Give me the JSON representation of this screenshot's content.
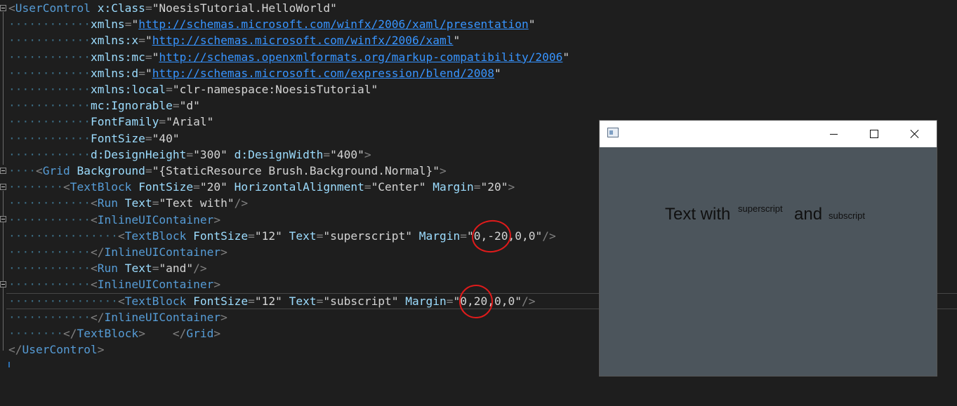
{
  "editor": {
    "lines": [
      {
        "indent": "",
        "parts": [
          [
            "pun",
            "<"
          ],
          [
            "tag",
            "UserControl"
          ],
          [
            "s",
            " "
          ],
          [
            "attr",
            "x:Class"
          ],
          [
            "pun",
            "="
          ],
          [
            "str",
            "\"NoesisTutorial.HelloWorld\""
          ]
        ]
      },
      {
        "indent": "············",
        "parts": [
          [
            "attr",
            "xmlns"
          ],
          [
            "pun",
            "="
          ],
          [
            "str",
            "\""
          ],
          [
            "url",
            "http://schemas.microsoft.com/winfx/2006/xaml/presentation"
          ],
          [
            "str",
            "\""
          ]
        ]
      },
      {
        "indent": "············",
        "parts": [
          [
            "attr",
            "xmlns:x"
          ],
          [
            "pun",
            "="
          ],
          [
            "str",
            "\""
          ],
          [
            "url",
            "http://schemas.microsoft.com/winfx/2006/xaml"
          ],
          [
            "str",
            "\""
          ]
        ]
      },
      {
        "indent": "············",
        "parts": [
          [
            "attr",
            "xmlns:mc"
          ],
          [
            "pun",
            "="
          ],
          [
            "str",
            "\""
          ],
          [
            "url",
            "http://schemas.openxmlformats.org/markup-compatibility/2006"
          ],
          [
            "str",
            "\""
          ]
        ]
      },
      {
        "indent": "············",
        "parts": [
          [
            "attr",
            "xmlns:d"
          ],
          [
            "pun",
            "="
          ],
          [
            "str",
            "\""
          ],
          [
            "url",
            "http://schemas.microsoft.com/expression/blend/2008"
          ],
          [
            "str",
            "\""
          ]
        ]
      },
      {
        "indent": "············",
        "parts": [
          [
            "attr",
            "xmlns:local"
          ],
          [
            "pun",
            "="
          ],
          [
            "str",
            "\"clr-namespace:NoesisTutorial\""
          ]
        ]
      },
      {
        "indent": "············",
        "parts": [
          [
            "attr",
            "mc:Ignorable"
          ],
          [
            "pun",
            "="
          ],
          [
            "str",
            "\"d\""
          ]
        ]
      },
      {
        "indent": "············",
        "parts": [
          [
            "attr",
            "FontFamily"
          ],
          [
            "pun",
            "="
          ],
          [
            "str",
            "\"Arial\""
          ]
        ]
      },
      {
        "indent": "············",
        "parts": [
          [
            "attr",
            "FontSize"
          ],
          [
            "pun",
            "="
          ],
          [
            "str",
            "\"40\""
          ]
        ]
      },
      {
        "indent": "············",
        "parts": [
          [
            "attr",
            "d:DesignHeight"
          ],
          [
            "pun",
            "="
          ],
          [
            "str",
            "\"300\""
          ],
          [
            "s",
            " "
          ],
          [
            "attr",
            "d:DesignWidth"
          ],
          [
            "pun",
            "="
          ],
          [
            "str",
            "\"400\""
          ],
          [
            "pun",
            ">"
          ]
        ]
      },
      {
        "indent": "····",
        "parts": [
          [
            "pun",
            "<"
          ],
          [
            "tag",
            "Grid"
          ],
          [
            "s",
            " "
          ],
          [
            "attr",
            "Background"
          ],
          [
            "pun",
            "="
          ],
          [
            "str",
            "\"{StaticResource Brush.Background.Normal}\""
          ],
          [
            "pun",
            ">"
          ]
        ]
      },
      {
        "indent": "········",
        "parts": [
          [
            "pun",
            "<"
          ],
          [
            "tag",
            "TextBlock"
          ],
          [
            "s",
            " "
          ],
          [
            "attr",
            "FontSize"
          ],
          [
            "pun",
            "="
          ],
          [
            "str",
            "\"20\""
          ],
          [
            "s",
            " "
          ],
          [
            "attr",
            "HorizontalAlignment"
          ],
          [
            "pun",
            "="
          ],
          [
            "str",
            "\"Center\""
          ],
          [
            "s",
            " "
          ],
          [
            "attr",
            "Margin"
          ],
          [
            "pun",
            "="
          ],
          [
            "str",
            "\"20\""
          ],
          [
            "pun",
            ">"
          ]
        ]
      },
      {
        "indent": "············",
        "parts": [
          [
            "pun",
            "<"
          ],
          [
            "tag",
            "Run"
          ],
          [
            "s",
            " "
          ],
          [
            "attr",
            "Text"
          ],
          [
            "pun",
            "="
          ],
          [
            "str",
            "\"Text with\""
          ],
          [
            "pun",
            "/>"
          ]
        ]
      },
      {
        "indent": "············",
        "parts": [
          [
            "pun",
            "<"
          ],
          [
            "tag",
            "InlineUIContainer"
          ],
          [
            "pun",
            ">"
          ]
        ]
      },
      {
        "indent": "················",
        "parts": [
          [
            "pun",
            "<"
          ],
          [
            "tag",
            "TextBlock"
          ],
          [
            "s",
            " "
          ],
          [
            "attr",
            "FontSize"
          ],
          [
            "pun",
            "="
          ],
          [
            "str",
            "\"12\""
          ],
          [
            "s",
            " "
          ],
          [
            "attr",
            "Text"
          ],
          [
            "pun",
            "="
          ],
          [
            "str",
            "\"superscript\""
          ],
          [
            "s",
            " "
          ],
          [
            "attr",
            "Margin"
          ],
          [
            "pun",
            "="
          ],
          [
            "str",
            "\"0,-20,0,0\""
          ],
          [
            "pun",
            "/>"
          ]
        ]
      },
      {
        "indent": "············",
        "parts": [
          [
            "pun",
            "</"
          ],
          [
            "tag",
            "InlineUIContainer"
          ],
          [
            "pun",
            ">"
          ]
        ]
      },
      {
        "indent": "············",
        "parts": [
          [
            "pun",
            "<"
          ],
          [
            "tag",
            "Run"
          ],
          [
            "s",
            " "
          ],
          [
            "attr",
            "Text"
          ],
          [
            "pun",
            "="
          ],
          [
            "str",
            "\"and\""
          ],
          [
            "pun",
            "/>"
          ]
        ]
      },
      {
        "indent": "············",
        "parts": [
          [
            "pun",
            "<"
          ],
          [
            "tag",
            "InlineUIContainer"
          ],
          [
            "pun",
            ">"
          ]
        ]
      },
      {
        "indent": "················",
        "parts": [
          [
            "pun",
            "<"
          ],
          [
            "tag",
            "TextBlock"
          ],
          [
            "s",
            " "
          ],
          [
            "attr",
            "FontSize"
          ],
          [
            "pun",
            "="
          ],
          [
            "str",
            "\"12\""
          ],
          [
            "s",
            " "
          ],
          [
            "attr",
            "Text"
          ],
          [
            "pun",
            "="
          ],
          [
            "str",
            "\"subscript\""
          ],
          [
            "s",
            " "
          ],
          [
            "attr",
            "Margin"
          ],
          [
            "pun",
            "="
          ],
          [
            "str",
            "\"0,20,0,0\""
          ],
          [
            "pun",
            "/>"
          ]
        ]
      },
      {
        "indent": "············",
        "parts": [
          [
            "pun",
            "</"
          ],
          [
            "tag",
            "InlineUIContainer"
          ],
          [
            "pun",
            ">"
          ]
        ]
      },
      {
        "indent": "········",
        "parts": [
          [
            "pun",
            "</"
          ],
          [
            "tag",
            "TextBlock"
          ],
          [
            "pun",
            ">"
          ],
          [
            "s",
            "    "
          ],
          [
            "pun",
            "</"
          ],
          [
            "tag",
            "Grid"
          ],
          [
            "pun",
            ">"
          ]
        ]
      },
      {
        "indent": "",
        "parts": [
          [
            "pun",
            "</"
          ],
          [
            "tag",
            "UserControl"
          ],
          [
            "pun",
            ">"
          ]
        ]
      }
    ],
    "colors": {
      "background": "#1e1e1e",
      "tag": "#569cd6",
      "attribute": "#9cdcfe",
      "string": "#d4d4d4",
      "link": "#3794ff",
      "annotation": "#e01b1b"
    }
  },
  "preview_window": {
    "icon": "app-window-icon",
    "minimize_icon": "minimize-icon",
    "maximize_icon": "maximize-icon",
    "close_icon": "close-icon",
    "background": "#4c555c",
    "run1": "Text with",
    "superscript": "superscript",
    "run2": "and",
    "subscript": "subscript"
  }
}
